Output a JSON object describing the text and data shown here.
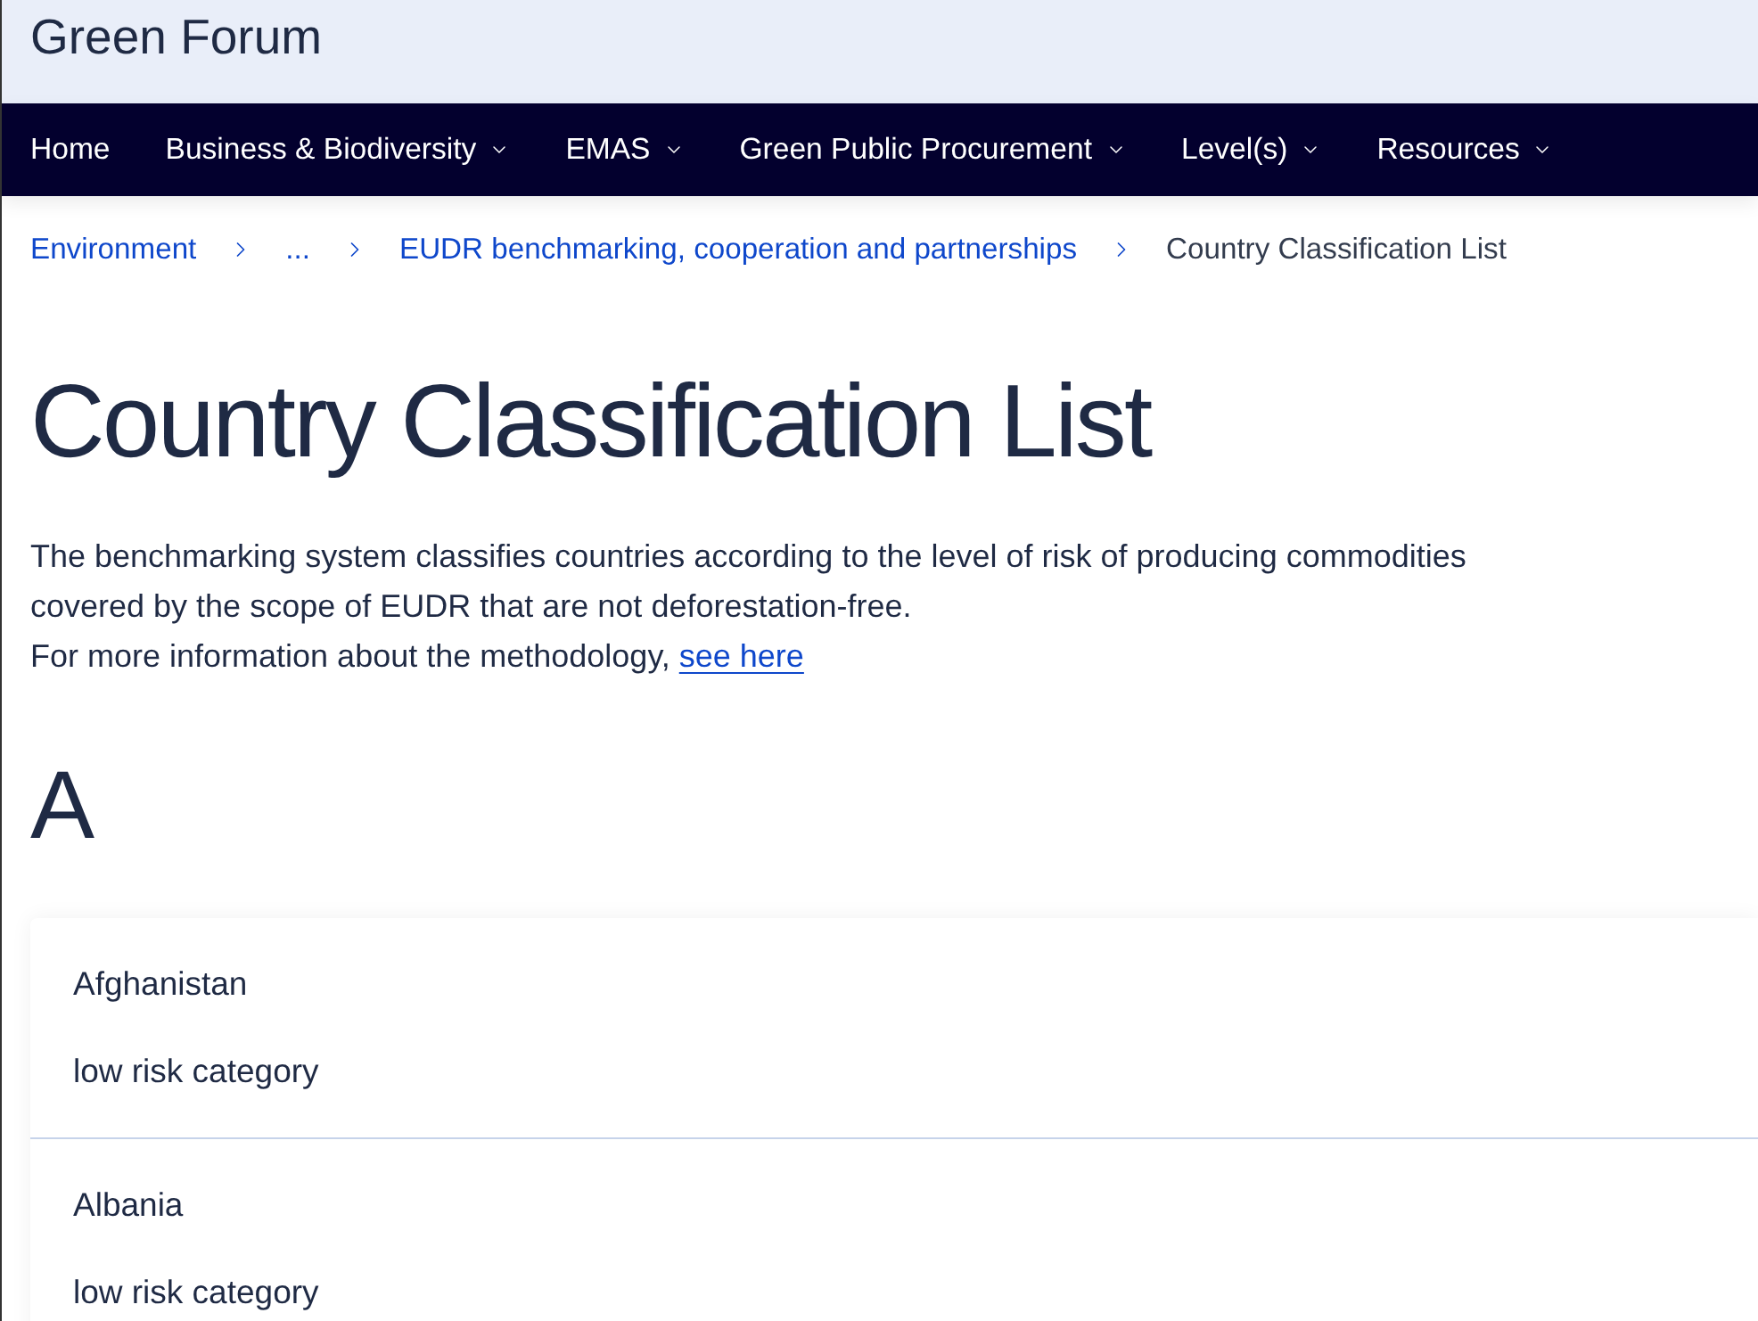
{
  "site": {
    "title": "Green Forum"
  },
  "nav": [
    {
      "label": "Home",
      "dropdown": false
    },
    {
      "label": "Business & Biodiversity",
      "dropdown": true
    },
    {
      "label": "EMAS",
      "dropdown": true
    },
    {
      "label": "Green Public Procurement",
      "dropdown": true
    },
    {
      "label": "Level(s)",
      "dropdown": true
    },
    {
      "label": "Resources",
      "dropdown": true
    }
  ],
  "breadcrumb": [
    {
      "label": "Environment",
      "kind": "link"
    },
    {
      "label": "...",
      "kind": "link"
    },
    {
      "label": "EUDR benchmarking, cooperation and partnerships",
      "kind": "link"
    },
    {
      "label": "Country Classification List",
      "kind": "current"
    }
  ],
  "page": {
    "title": "Country Classification List",
    "intro": "The benchmarking system classifies countries according to the level of risk of producing commodities covered by the scope of EUDR that are not deforestation-free.",
    "more_info": "For more information about the methodology,",
    "more_info_link": "see here"
  },
  "sections": [
    {
      "letter": "A",
      "countries": [
        {
          "name": "Afghanistan",
          "category": "low risk category"
        },
        {
          "name": "Albania",
          "category": "low risk category"
        }
      ]
    }
  ]
}
